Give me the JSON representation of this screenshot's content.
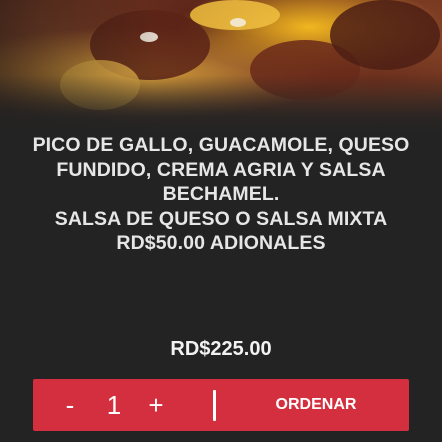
{
  "description": {
    "lines": [
      "PICO DE GALLO, GUACAMOLE, QUESO",
      "FUNDIDO, CREMA AGRIA Y SALSA",
      "BECHAMEL.",
      "SALSA DE QUESO O SALSA MIXTA",
      "RD$50.00 ADIONALES"
    ]
  },
  "price": "RD$225.00",
  "order_bar": {
    "minus": "-",
    "quantity": "1",
    "plus": "+",
    "order_label": "ORDENAR",
    "color": "#d42f3f"
  },
  "colors": {
    "background": "#232323",
    "text": "#e6e6e6"
  }
}
